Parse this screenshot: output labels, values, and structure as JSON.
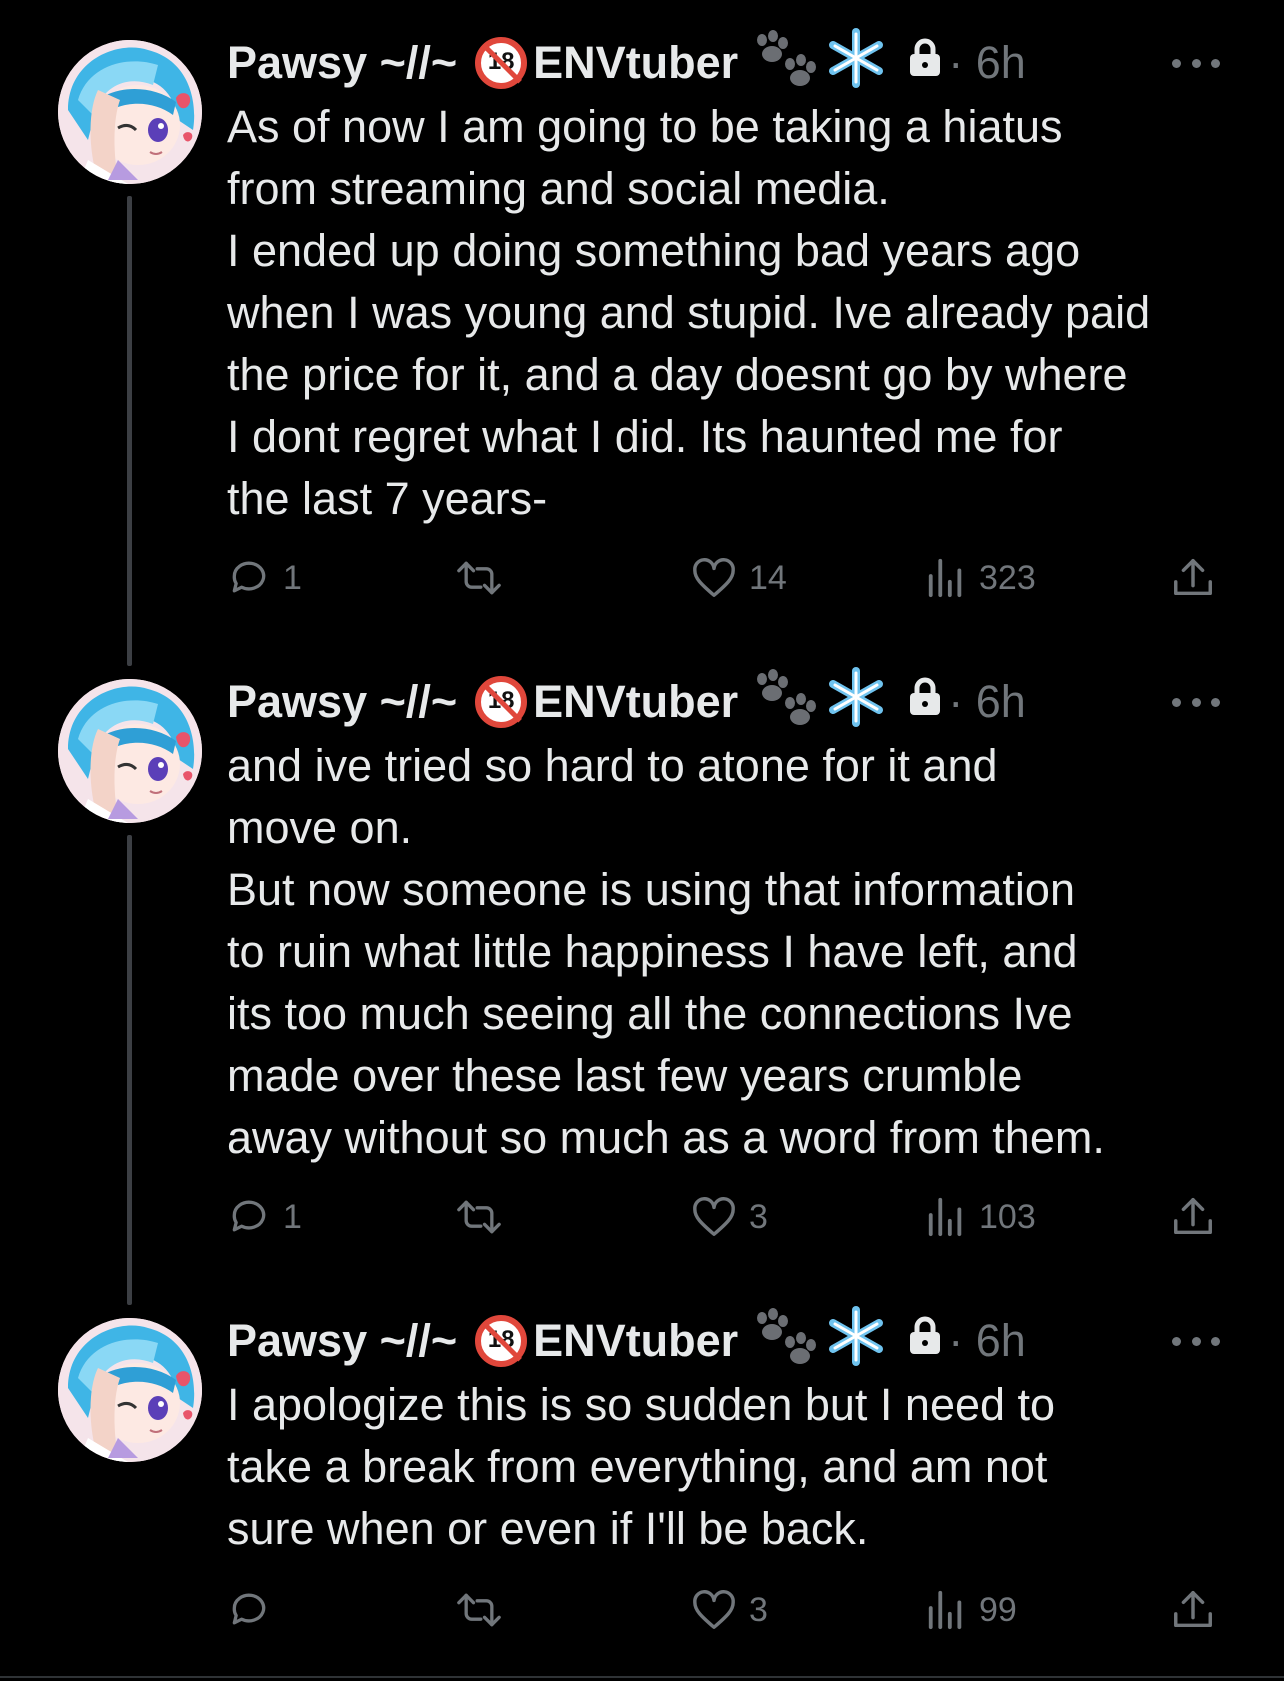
{
  "tweets": [
    {
      "display_name": "Pawsy ~//~",
      "age_badge": "18",
      "tag": "ENVtuber",
      "emojis": [
        "paw-prints-icon",
        "snowflake-icon"
      ],
      "time": "· 6h",
      "text": "As of now I am going to be taking a hiatus\nfrom streaming and social media.\nI ended up doing something bad years ago\nwhen I was young and stupid. Ive already paid\nthe price for it, and a day doesnt go by where\nI dont regret what I did. Its haunted me for\nthe last 7 years-",
      "replies": "1",
      "reposts": "",
      "likes": "14",
      "views": "323"
    },
    {
      "display_name": "Pawsy ~//~",
      "age_badge": "18",
      "tag": "ENVtuber",
      "emojis": [
        "paw-prints-icon",
        "snowflake-icon"
      ],
      "time": "· 6h",
      "text": "and ive tried so hard to atone for it and\nmove on.\nBut now someone is using that information\nto ruin what little happiness I have left, and\nits too much seeing all the connections Ive\nmade over these last few years crumble\naway without so much as a word from them.",
      "replies": "1",
      "reposts": "",
      "likes": "3",
      "views": "103"
    },
    {
      "display_name": "Pawsy ~//~",
      "age_badge": "18",
      "tag": "ENVtuber",
      "emojis": [
        "paw-prints-icon",
        "snowflake-icon"
      ],
      "time": "· 6h",
      "text": "I apologize this is so sudden but I need to\ntake a break from everything, and am not\nsure when or even if I'll be back.",
      "replies": "",
      "reposts": "",
      "likes": "3",
      "views": "99"
    }
  ],
  "colors": {
    "background": "#000000",
    "text": "#e7e9ea",
    "muted": "#71767b",
    "thread_line": "#3c3f44",
    "badge_red": "#e0473b",
    "snowflake": "#6fc3ef"
  }
}
